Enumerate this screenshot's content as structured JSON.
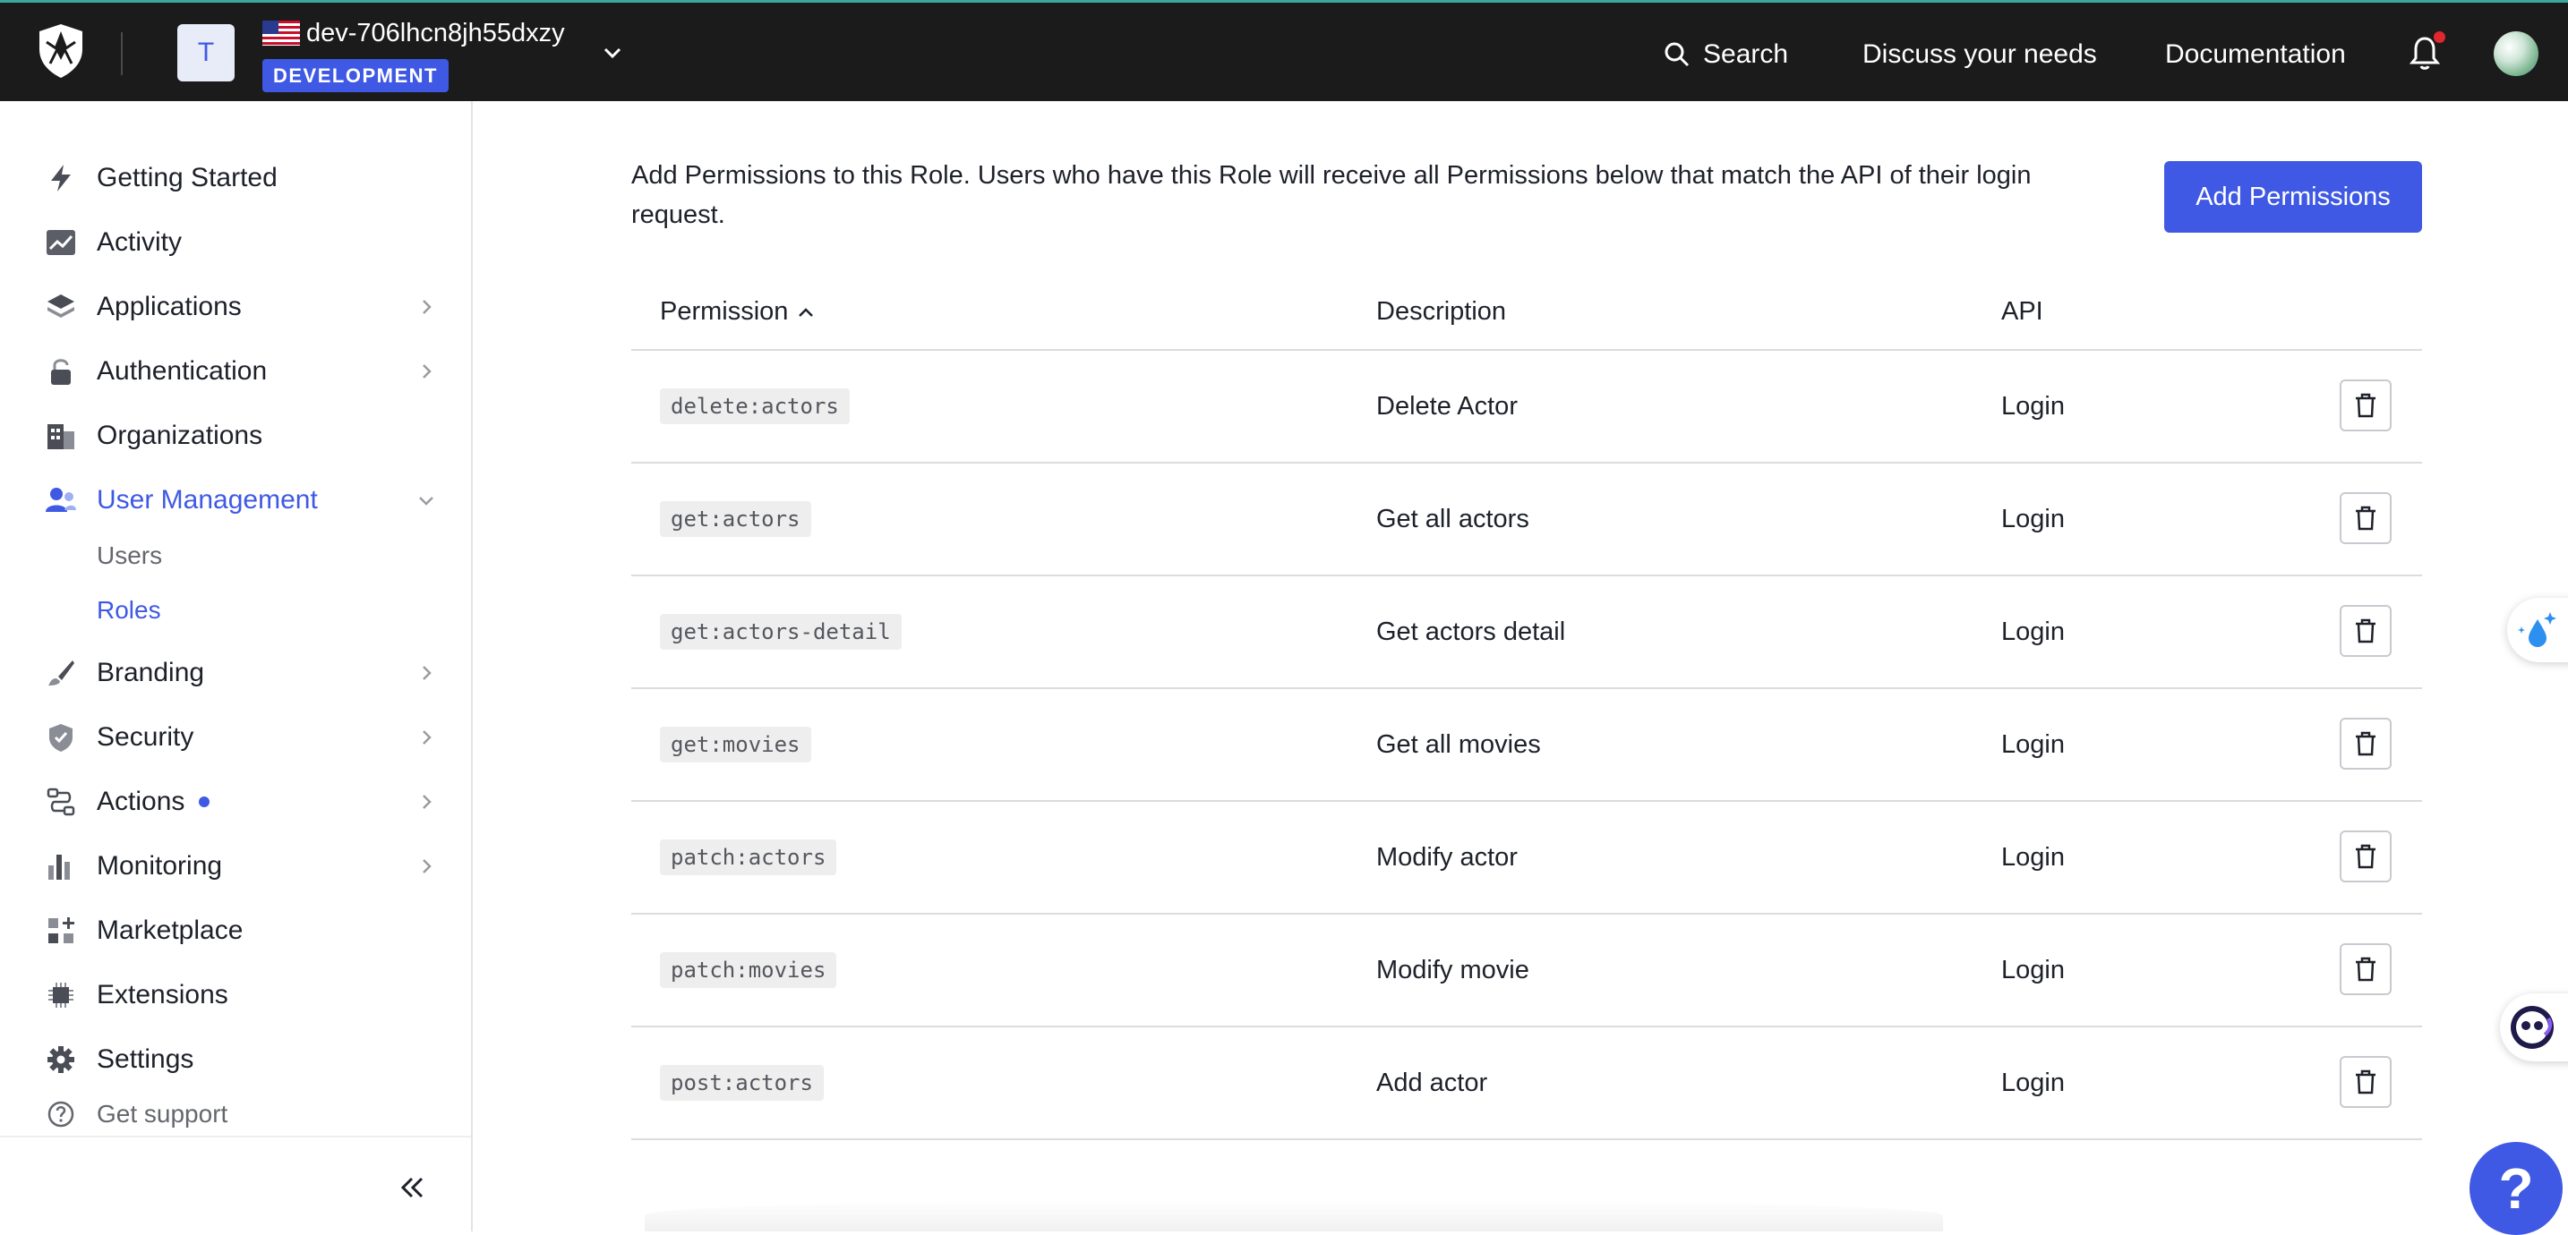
{
  "topbar": {
    "tenant_initial": "T",
    "tenant_name": "dev-706lhcn8jh55dxzy",
    "environment": "DEVELOPMENT",
    "search_label": "Search",
    "discuss_label": "Discuss your needs",
    "docs_label": "Documentation"
  },
  "sidebar": {
    "items": [
      {
        "label": "Getting Started",
        "icon": "lightning-icon"
      },
      {
        "label": "Activity",
        "icon": "activity-chart-icon"
      },
      {
        "label": "Applications",
        "icon": "layers-icon"
      },
      {
        "label": "Authentication",
        "icon": "lock-icon"
      },
      {
        "label": "Organizations",
        "icon": "building-icon"
      },
      {
        "label": "User Management",
        "icon": "users-icon"
      },
      {
        "label": "Branding",
        "icon": "brush-icon"
      },
      {
        "label": "Security",
        "icon": "shield-icon"
      },
      {
        "label": "Actions",
        "icon": "flow-icon"
      },
      {
        "label": "Monitoring",
        "icon": "bar-chart-icon"
      },
      {
        "label": "Marketplace",
        "icon": "grid-plus-icon"
      },
      {
        "label": "Extensions",
        "icon": "chip-icon"
      },
      {
        "label": "Settings",
        "icon": "gear-icon"
      }
    ],
    "sub_items": [
      "Users",
      "Roles"
    ],
    "support_label": "Get support"
  },
  "main": {
    "intro": "Add Permissions to this Role. Users who have this Role will receive all Permissions below that match the API of their login request.",
    "add_button": "Add Permissions",
    "columns": [
      "Permission",
      "Description",
      "API"
    ],
    "rows": [
      {
        "permission": "delete:actors",
        "description": "Delete Actor",
        "api": "Login"
      },
      {
        "permission": "get:actors",
        "description": "Get all actors",
        "api": "Login"
      },
      {
        "permission": "get:actors-detail",
        "description": "Get actors detail",
        "api": "Login"
      },
      {
        "permission": "get:movies",
        "description": "Get all movies",
        "api": "Login"
      },
      {
        "permission": "patch:actors",
        "description": "Modify actor",
        "api": "Login"
      },
      {
        "permission": "patch:movies",
        "description": "Modify movie",
        "api": "Login"
      },
      {
        "permission": "post:actors",
        "description": "Add actor",
        "api": "Login"
      }
    ]
  },
  "widgets": {
    "help_glyph": "?"
  },
  "colors": {
    "accent": "#3f59e4",
    "topbar_bg": "#1b1b1b",
    "notification_dot": "#e0272f"
  }
}
